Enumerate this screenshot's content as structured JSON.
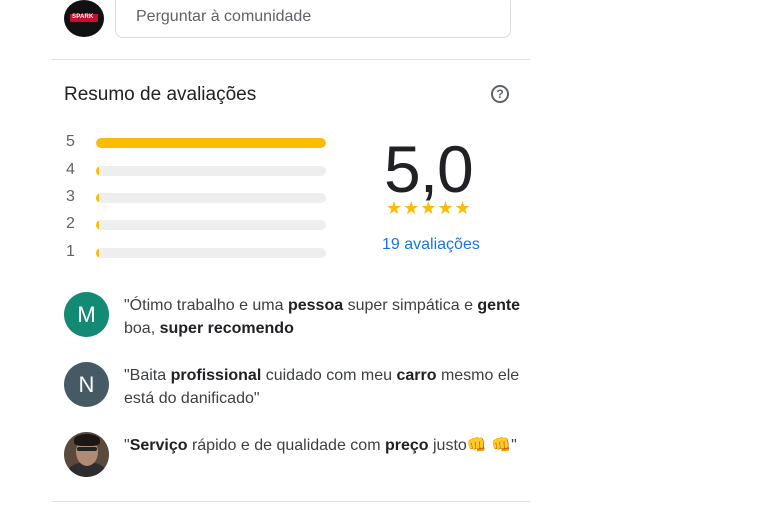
{
  "header": {
    "logo_text": "SPARK",
    "ask_placeholder": "Perguntar à comunidade"
  },
  "summary": {
    "title": "Resumo de avaliações",
    "help_icon": "help-circle-icon",
    "rating": "5,0",
    "stars": "★★★★★",
    "reviews_count": "19 avaliações",
    "distribution": [
      {
        "label": "5",
        "fraction": 1.0
      },
      {
        "label": "4",
        "fraction": 0.0
      },
      {
        "label": "3",
        "fraction": 0.0
      },
      {
        "label": "2",
        "fraction": 0.0
      },
      {
        "label": "1",
        "fraction": 0.0
      }
    ]
  },
  "snippets": [
    {
      "avatar": "M",
      "avatar_color": "#138a74",
      "html": "\"Ótimo trabalho e uma <b>pessoa</b> super simpática e <b>gente</b> boa, <b>super recomendo</b>"
    },
    {
      "avatar": "N",
      "avatar_color": "#455a64",
      "html": "\"Baita <b>profissional</b> cuidado com meu <b>carro</b> mesmo ele está do danificado\""
    },
    {
      "avatar": "",
      "avatar_color": "",
      "html": "\"<b>Serviço</b> rápido e de qualidade com <b>preço</b> justo👊 👊\""
    }
  ],
  "colors": {
    "accent_star": "#fbbc04",
    "link": "#1a73e8"
  }
}
